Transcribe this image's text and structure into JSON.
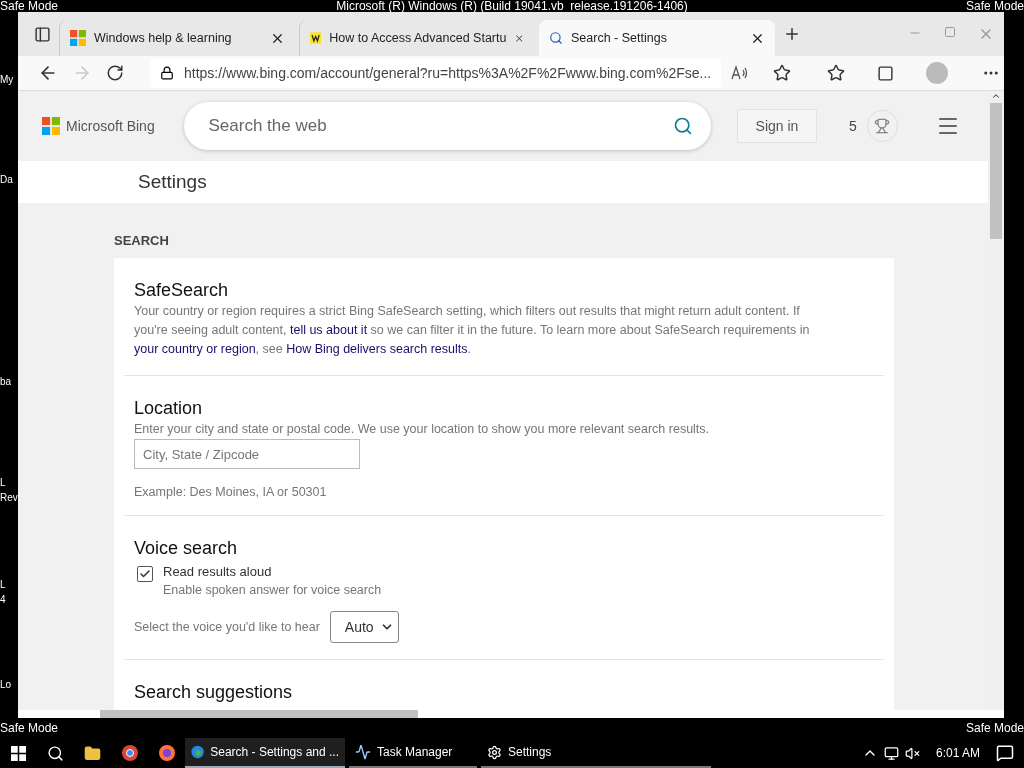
{
  "desktop": {
    "title": "Microsoft (R) Windows (R) (Build 19041.vb_release.191206-1406)",
    "corner_labels": [
      "Safe Mode",
      "Safe Mode",
      "Safe Mode",
      "Safe Mode"
    ],
    "icon_labels": [
      {
        "lines": [
          "My"
        ]
      },
      {
        "lines": [
          "Da"
        ]
      },
      {
        "lines": [
          "ba"
        ]
      },
      {
        "lines": [
          "L",
          "Rev"
        ]
      },
      {
        "lines": [
          "L",
          "4"
        ]
      },
      {
        "lines": [
          "Lo"
        ]
      }
    ]
  },
  "browser": {
    "tabs": [
      {
        "kind": "windows",
        "title": "Windows help & learning",
        "selected": false
      },
      {
        "kind": "site",
        "title": "How to Access Advanced Startu",
        "selected": false
      },
      {
        "kind": "search",
        "title": "Search - Settings",
        "selected": true
      }
    ],
    "url": "https://www.bing.com/account/general?ru=https%3A%2F%2Fwww.bing.com%2Fse..."
  },
  "page": {
    "logo": "Microsoft Bing",
    "search_placeholder": "Search the web",
    "sign_in": "Sign in",
    "rewards": "5",
    "title": "Settings",
    "section": "SEARCH",
    "groups": [
      {
        "kind": "text",
        "title": "SafeSearch",
        "segments": [
          {
            "text": "Your country or region requires a strict Bing SafeSearch setting, which filters out results that might return adult content. If you're seeing adult content, ",
            "link": false
          },
          {
            "text": "tell us about it",
            "link": true
          },
          {
            "text": " so we can filter it in the future. To learn more about SafeSearch requirements in ",
            "link": false
          },
          {
            "text": "your country or region",
            "link": true
          },
          {
            "text": ", see ",
            "link": false
          },
          {
            "text": "How Bing delivers search results",
            "link": true
          },
          {
            "text": ".",
            "link": false
          }
        ]
      },
      {
        "kind": "location",
        "title": "Location",
        "description": "Enter your city and state or postal code. We use your location to show you more relevant search results.",
        "placeholder": "City, State / Zipcode",
        "example": "Example: Des Moines, IA or 50301"
      },
      {
        "kind": "voice",
        "title": "Voice search",
        "checkbox": {
          "label": "Read results aloud",
          "sublabel": "Enable spoken answer for voice search",
          "checked": true
        },
        "select_label": "Select the voice you'd like to hear",
        "select_value": "Auto"
      },
      {
        "kind": "heading",
        "title": "Search suggestions"
      }
    ]
  },
  "taskbar": {
    "apps": [
      {
        "kind": "edge",
        "label": "Search - Settings and ...",
        "selected": true
      },
      {
        "kind": "taskmgr",
        "label": "Task Manager",
        "selected": false
      },
      {
        "kind": "settings",
        "label": "Settings",
        "selected": false
      }
    ],
    "time": "6:01 AM"
  }
}
